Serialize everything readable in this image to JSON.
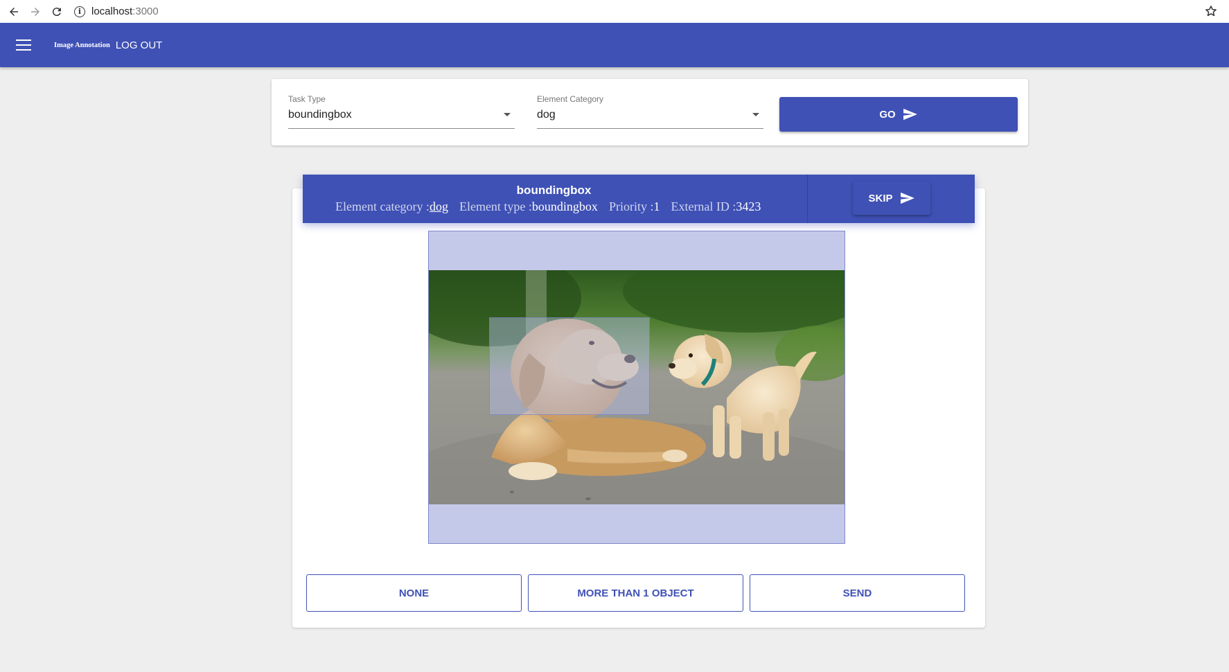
{
  "browser": {
    "url_host": "localhost",
    "url_port": ":3000"
  },
  "app_bar": {
    "title": "Image Annotation",
    "logout_label": "LOG OUT"
  },
  "task_form": {
    "task_type_label": "Task Type",
    "task_type_value": "boundingbox",
    "element_category_label": "Element Category",
    "element_category_value": "dog",
    "go_label": "GO"
  },
  "annotation": {
    "title": "boundingbox",
    "element_category_label": "Element category :",
    "element_category_value": "dog",
    "element_type_label": "Element type :",
    "element_type_value": "boundingbox",
    "priority_label": "Priority :",
    "priority_value": "1",
    "external_id_label": "External ID :",
    "external_id_value": "3423",
    "skip_label": "SKIP"
  },
  "actions": {
    "none_label": "NONE",
    "more_than_one_label": "MORE THAN 1 OBJECT",
    "send_label": "SEND"
  },
  "colors": {
    "primary": "#3f51b5",
    "canvas_bg": "#c5c9e9"
  },
  "icons": [
    "arrow-back-icon",
    "arrow-forward-icon",
    "reload-icon",
    "info-icon",
    "star-icon",
    "menu-icon",
    "send-icon",
    "dropdown-caret-icon"
  ]
}
